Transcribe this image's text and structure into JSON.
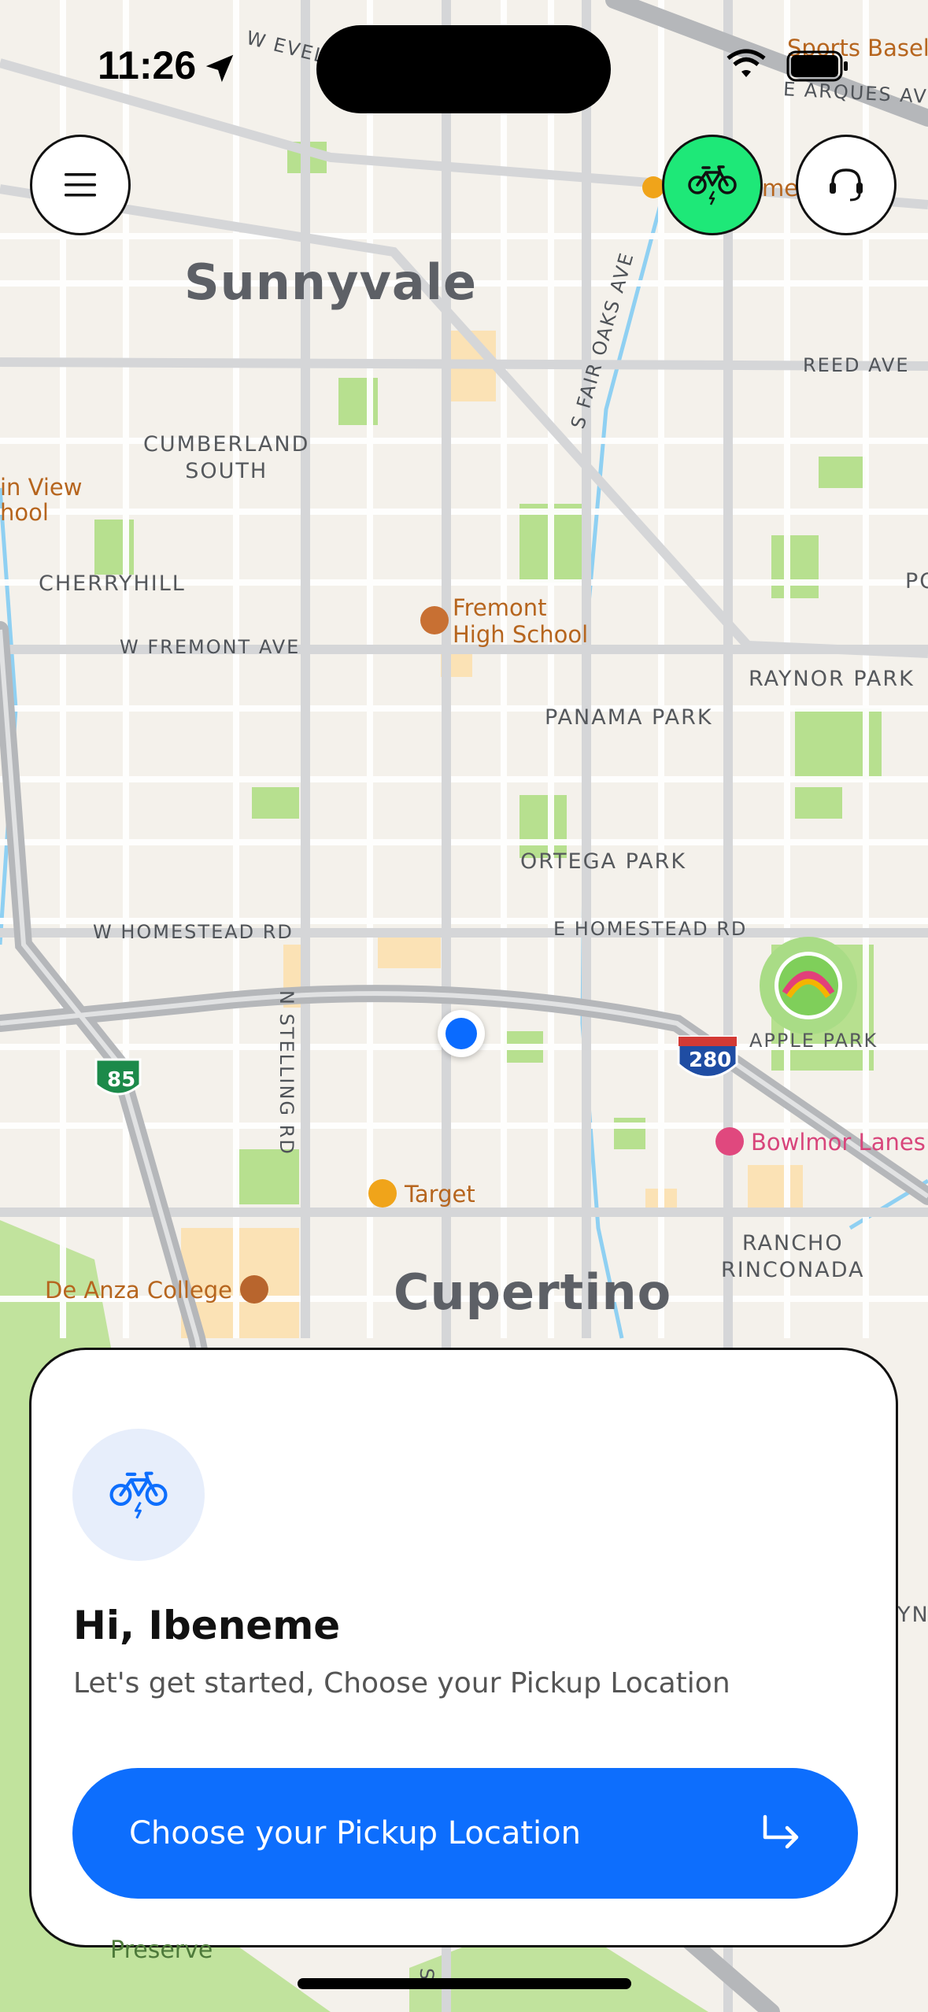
{
  "status_bar": {
    "time": "11:26"
  },
  "map": {
    "cities": {
      "sunnyvale": "Sunnyvale",
      "cupertino": "Cupertino"
    },
    "areas": {
      "cumberland": "CUMBERLAND\nSOUTH",
      "cherryhill": "CHERRYHILL",
      "panama_park": "PANAMA PARK",
      "raynor_park": "RAYNOR PARK",
      "ortega_park": "ORTEGA PARK",
      "rancho": "RANCHO\nRINCONADA",
      "apple_park": "APPLE PARK",
      "mountain_view_school": "in View\nhool",
      "preserve": "Preserve",
      "po": "PO",
      "yn": "YN"
    },
    "roads": {
      "w_evelyn": "W EVEL",
      "e_arques": "E ARQUES AV",
      "reed_ave": "REED AVE",
      "s_fair_oaks": "S FAIR OAKS AVE",
      "w_fremont": "W FREMONT AVE",
      "w_homestead": "W HOMESTEAD RD",
      "e_homestead": "E HOMESTEAD RD",
      "n_stelling": "N STELLING RD",
      "s": "S"
    },
    "pois": {
      "sports": "Sports Basel",
      "fremont_hs": "Fremont\nHigh School",
      "target": "Target",
      "de_anza": "De Anza College",
      "bowlmor": "Bowlmor Lanes",
      "me": "me"
    },
    "shields": {
      "hwy85": "85",
      "i280": "280"
    }
  },
  "buttons": {
    "menu_icon": "hamburger-menu-icon",
    "bike_icon": "bike-icon",
    "support_icon": "headset-icon"
  },
  "sheet": {
    "greeting": "Hi, Ibeneme",
    "subtitle": "Let's get started, Choose your Pickup Location",
    "cta_label": "Choose your Pickup Location",
    "cta_icon": "arrow-turn-right-icon"
  }
}
